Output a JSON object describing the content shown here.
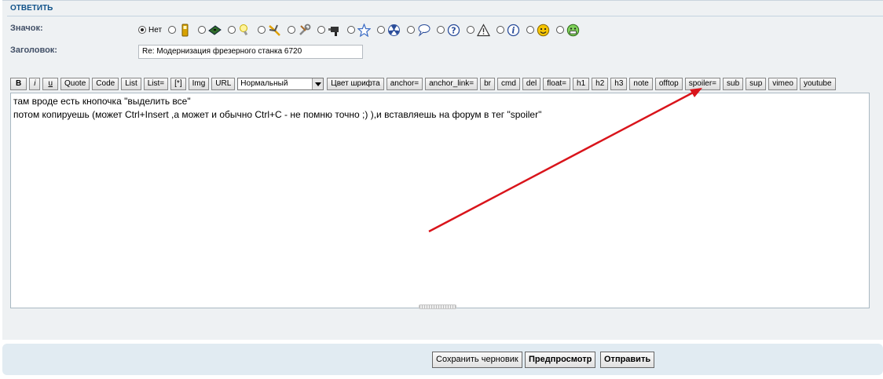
{
  "panel": {
    "title": "ОТВЕТИТЬ",
    "icon_label": "Значок:",
    "subject_label": "Заголовок:",
    "subject_value": "Re: Модернизация фрезерного станка 6720"
  },
  "icons": {
    "none_label": "Нет",
    "options": [
      "phone-icon",
      "chip-board-icon",
      "bulb-icon",
      "pliers-icon",
      "wrench-icon",
      "drill-icon",
      "star-icon",
      "radiation-icon",
      "speech-bubble-icon",
      "question-icon",
      "warning-icon",
      "info-icon",
      "smile-icon",
      "grin-icon"
    ]
  },
  "toolbar": {
    "buttons_before_select": [
      "B",
      "i",
      "u",
      "Quote",
      "Code",
      "List",
      "List=",
      "[*]",
      "Img",
      "URL"
    ],
    "size_select_value": "Нормальный",
    "buttons_after_select": [
      "Цвет шрифта",
      "anchor=",
      "anchor_link=",
      "br",
      "cmd",
      "del",
      "float=",
      "h1",
      "h2",
      "h3",
      "note",
      "offtop",
      "spoiler=",
      "sub",
      "sup",
      "vimeo",
      "youtube"
    ]
  },
  "editor": {
    "lines": [
      "там вроде есть кнопочка \"выделить все\"",
      "потом копируешь (может Ctrl+Insert ,а может и обычно Ctrl+C - не помню точно ;) ),и вставляешь на форум в тег \"spoiler\""
    ]
  },
  "footer": {
    "save_draft": "Сохранить черновик",
    "preview": "Предпросмотр",
    "submit": "Отправить"
  },
  "annotation_arrow_color": "#d9141b"
}
